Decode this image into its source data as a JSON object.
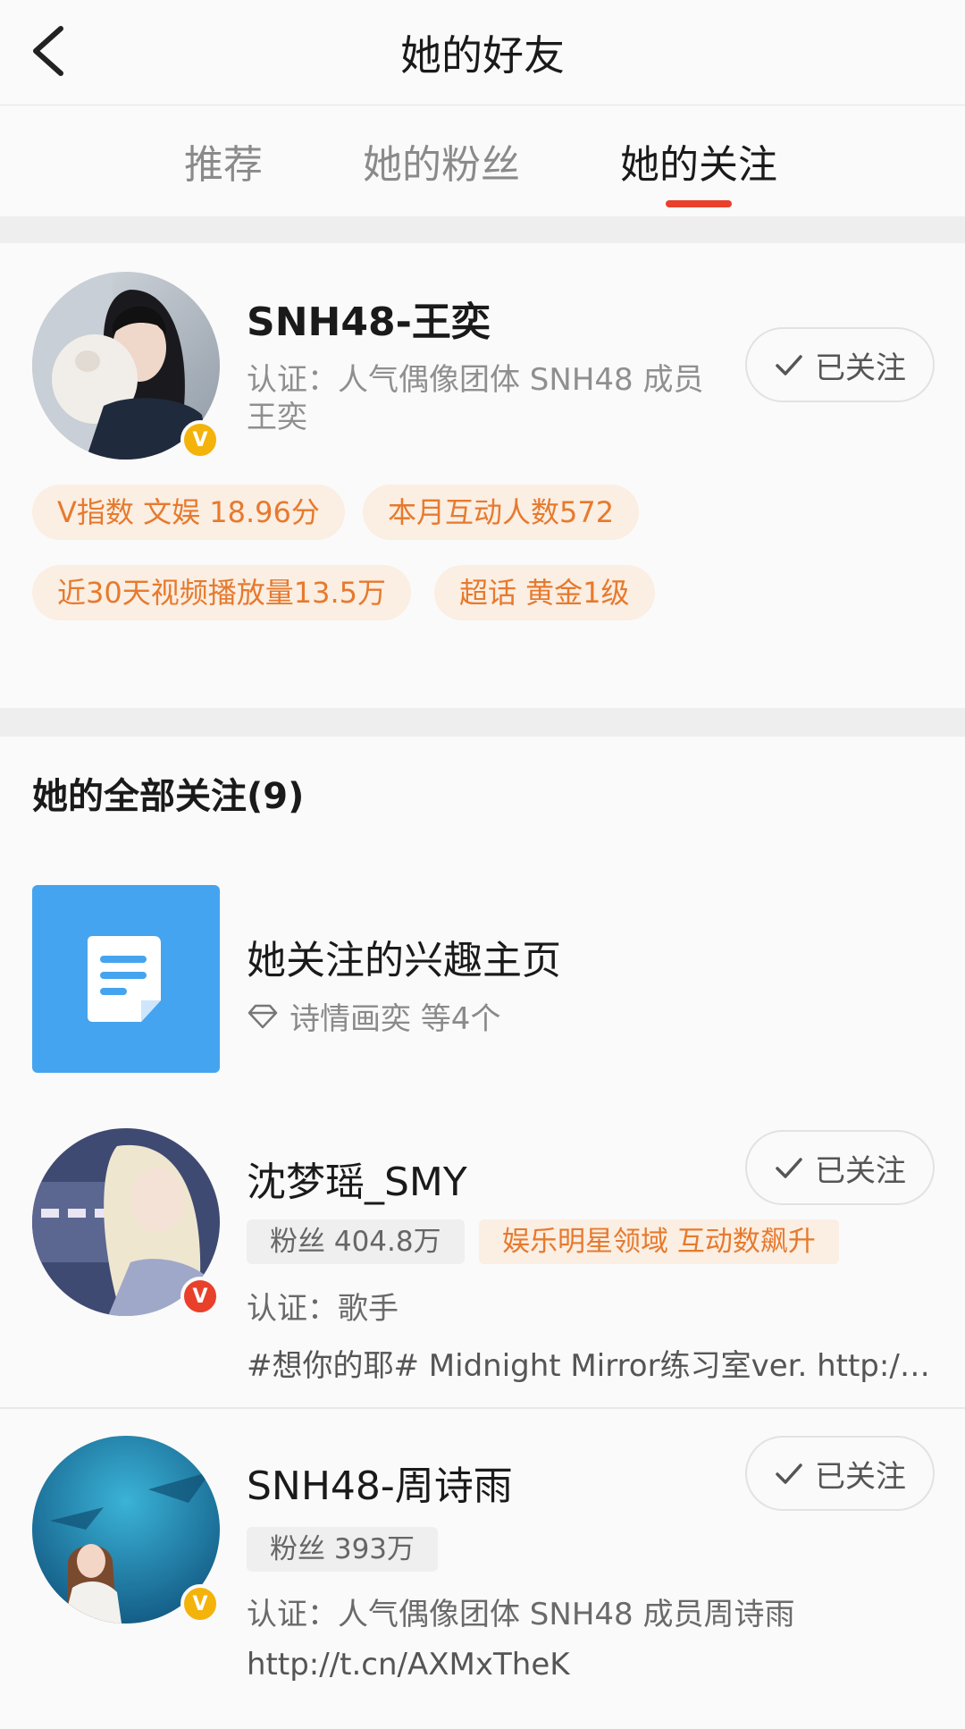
{
  "header": {
    "title": "她的好友"
  },
  "tabs": [
    {
      "label": "推荐",
      "active": false
    },
    {
      "label": "她的粉丝",
      "active": false
    },
    {
      "label": "她的关注",
      "active": true
    }
  ],
  "profile": {
    "name": "SNH48-王奕",
    "verification_line1": "认证：人气偶像团体 SNH48 成员",
    "verification_line2": "王奕",
    "follow_label": "已关注",
    "badge": "V",
    "pills": [
      "V指数 文娱 18.96分",
      "本月互动人数572",
      "近30天视频播放量13.5万",
      "超话 黄金1级"
    ]
  },
  "section": {
    "title": "她的全部关注(9)"
  },
  "interest": {
    "title": "她关注的兴趣主页",
    "subtitle": "诗情画奕 等4个"
  },
  "users": [
    {
      "name": "沈梦瑶_SMY",
      "follow_label": "已关注",
      "fans": "粉丝 404.8万",
      "trend_tag": "娱乐明星领域 互动数飙升",
      "verification": "认证：歌手",
      "desc": "#想你的耶# Midnight Mirror练习室ver. http://t....",
      "badge": "V",
      "badge_color": "#e8402b"
    },
    {
      "name": "SNH48-周诗雨",
      "follow_label": "已关注",
      "fans": "粉丝 393万",
      "verification": "认证：人气偶像团体 SNH48 成员周诗雨",
      "desc": "http://t.cn/AXMxTheK",
      "badge": "V",
      "badge_color": "#f3b30b"
    }
  ],
  "colors": {
    "accent": "#e8402b",
    "pill_text": "#e67a2e",
    "pill_bg": "#fbeee2",
    "interest_icon_bg": "#45a4ef",
    "verified_gold": "#f3b30b"
  },
  "icons": [
    "back-arrow-icon",
    "checkmark-icon",
    "document-icon",
    "diamond-icon",
    "verified-v-icon"
  ]
}
